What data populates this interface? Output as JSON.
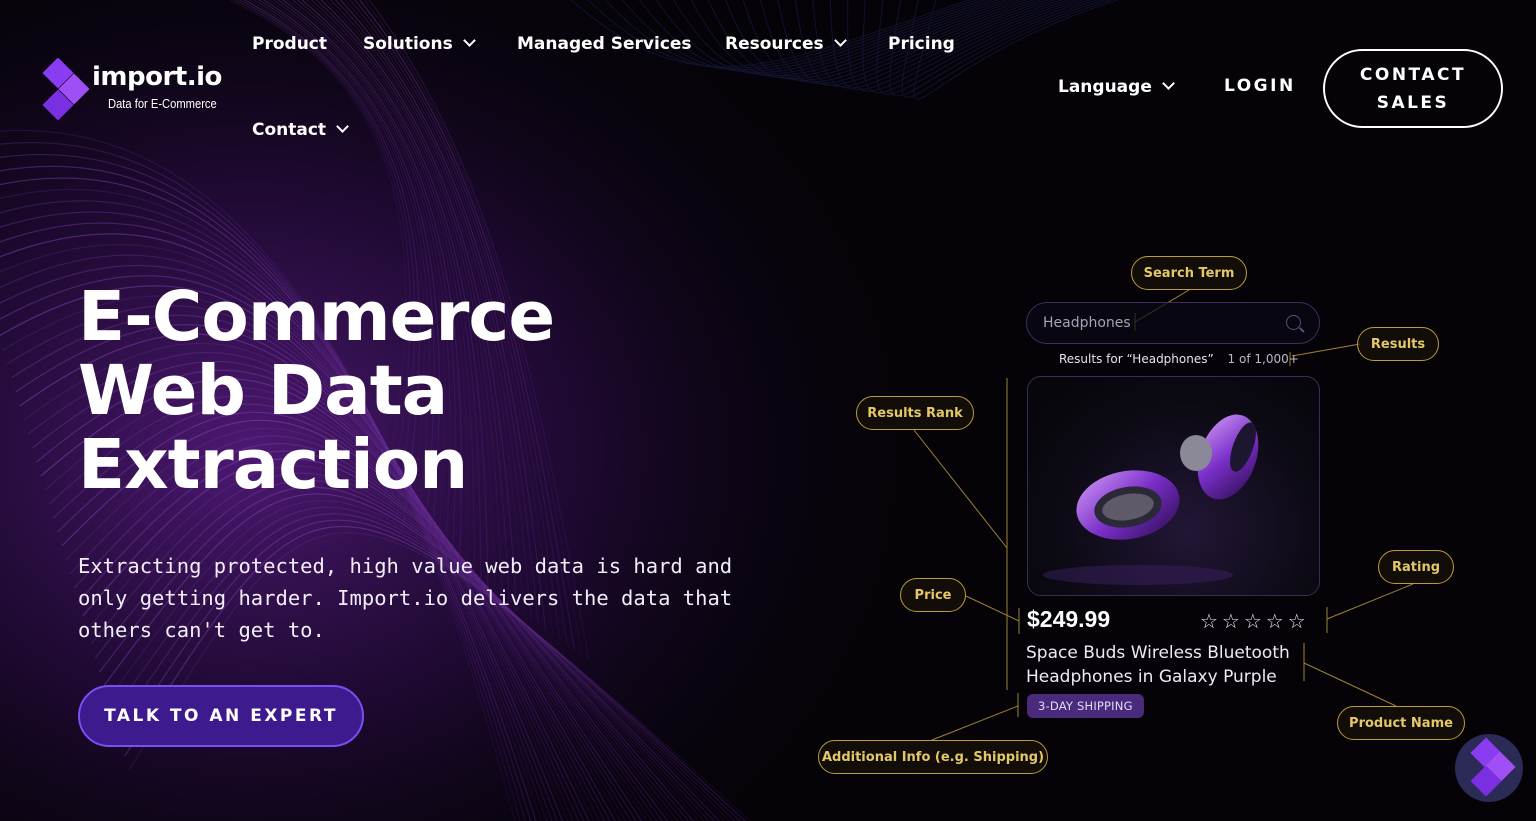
{
  "brand": {
    "name": "import.io",
    "tagline": "Data for E-Commerce",
    "colors": {
      "accent": "#7b4ef0",
      "cta_bg": "#3e1a8f",
      "tag_gold": "#e3c86a",
      "logo_purple": "#8a3cf0"
    }
  },
  "nav": {
    "items": [
      {
        "label": "Product"
      },
      {
        "label": "Solutions"
      },
      {
        "label": "Managed Services"
      },
      {
        "label": "Resources"
      },
      {
        "label": "Pricing"
      },
      {
        "label": "Contact"
      }
    ],
    "language_label": "Language",
    "login_label": "LOGIN",
    "contact_sales_label": "CONTACT SALES"
  },
  "hero": {
    "title_lines": [
      "E-Commerce",
      "Web Data",
      "Extraction"
    ],
    "subtitle": "Extracting protected, high value web data is hard and only getting harder. Import.io delivers the data that others can't get to.",
    "cta_label": "TALK TO AN EXPERT"
  },
  "graphic": {
    "search_placeholder": "Headphones",
    "results_text": "Results for “Headphones”",
    "results_count": "1 of 1,000+",
    "price": "$249.99",
    "rating_stars": "☆☆☆☆☆",
    "product_name": "Space Buds Wireless Bluetooth Headphones in Galaxy Purple",
    "shipping_badge": "3-DAY SHIPPING",
    "tags": {
      "search_term": "Search Term",
      "results": "Results",
      "results_rank": "Results Rank",
      "price": "Price",
      "rating": "Rating",
      "product_name": "Product Name",
      "additional_info": "Additional Info (e.g. Shipping)"
    }
  },
  "icons": {
    "chevron": "chevron-down-icon",
    "search": "search-icon",
    "star": "star-icon",
    "chat": "chat-launcher-icon"
  }
}
